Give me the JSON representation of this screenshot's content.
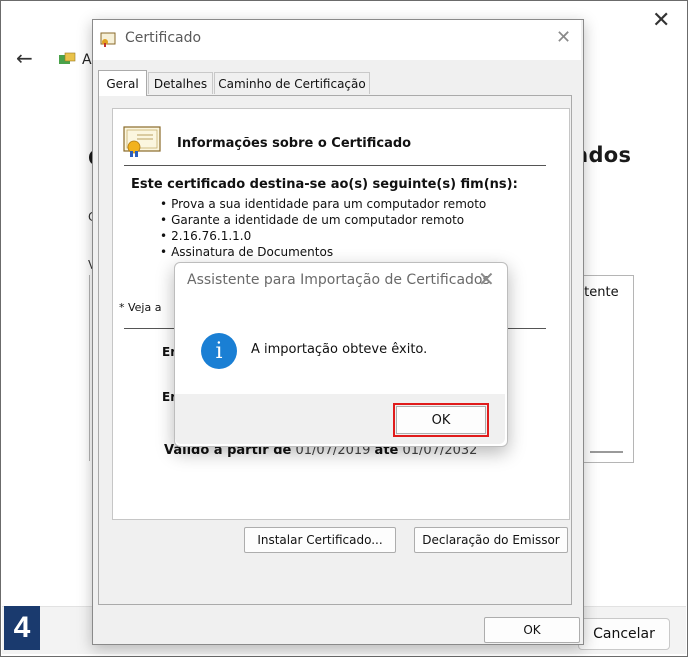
{
  "background_window": {
    "heading_fragment": "ados",
    "title_fragment": "A",
    "left_fragment": "C",
    "left_fragment_2": "C",
    "left_fragment_3": "V",
    "list_fragment": "sistente",
    "next_button_label": "",
    "cancel_button_label": "Cancelar",
    "close_icon": "close-icon",
    "back_icon": "back-arrow-icon"
  },
  "step_badge": "4",
  "certificate_window": {
    "title": "Certificado",
    "tabs": [
      {
        "label": "Geral"
      },
      {
        "label": "Detalhes"
      },
      {
        "label": "Caminho de Certificação"
      }
    ],
    "info_heading": "Informações sobre o Certificado",
    "purpose_heading": "Este certificado destina-se ao(s) seguinte(s) fim(ns):",
    "purposes": [
      "Prova a sua identidade para um computador remoto",
      "Garante a identidade de um computador remoto",
      "2.16.76.1.1.0",
      "Assinatura de Documentos"
    ],
    "see_note": "* Veja a",
    "issued_to_fragment": "Er",
    "issued_by_fragment": "Er",
    "valid_from_label": "Válido a partir de",
    "valid_from": "01/07/2019",
    "valid_to_label": "até",
    "valid_to": "01/07/2032",
    "install_button": "Instalar Certificado...",
    "issuer_statement_button": "Declaração do Emissor",
    "ok_button": "OK"
  },
  "import_dialog": {
    "title": "Assistente para Importação de Certificados",
    "message": "A importação obteve êxito.",
    "ok_button": "OK",
    "icon": "info-icon"
  },
  "colors": {
    "accent": "#0067c0",
    "highlight": "#e01b1b",
    "info_icon": "#1a7fd4",
    "badge": "#1a3a6e"
  }
}
